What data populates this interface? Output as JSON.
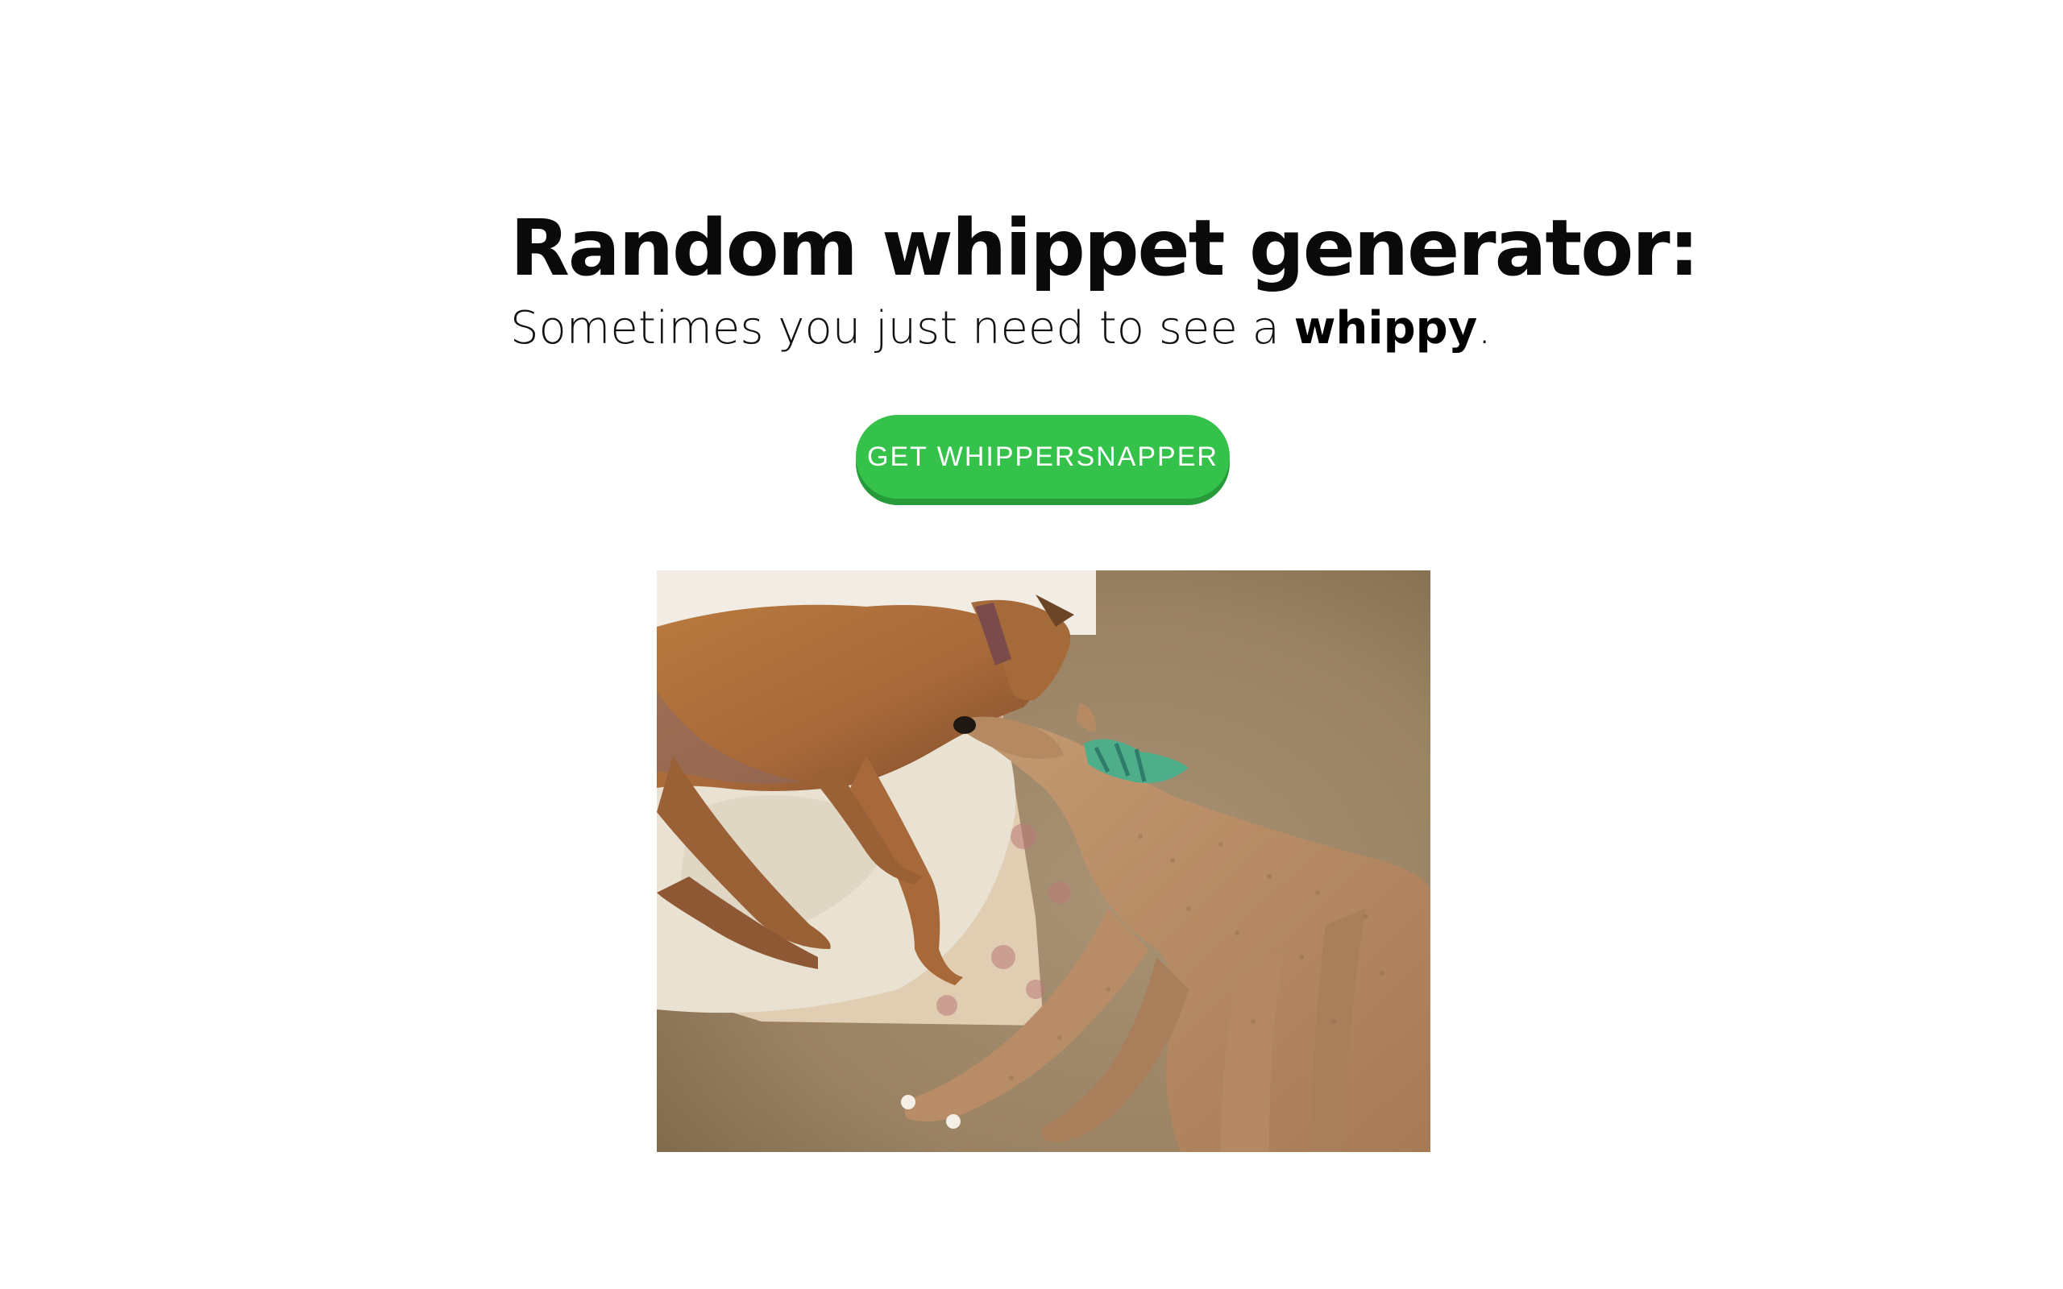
{
  "header": {
    "title": "Random whippet generator:",
    "subtitle_prefix": "Sometimes you just need to see a ",
    "subtitle_emphasis": "whippy",
    "subtitle_suffix": "."
  },
  "action": {
    "button_label": "GET WHIPPERSNAPPER"
  },
  "colors": {
    "button": "#34c24a",
    "button_shadow": "#279a3a",
    "title_text": "#0a0a0a",
    "background": "#ffffff"
  },
  "photo": {
    "subject": "whippet-photo"
  }
}
